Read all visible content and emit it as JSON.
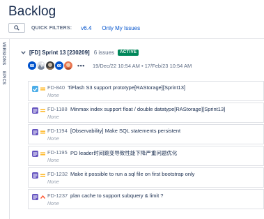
{
  "page": {
    "title": "Backlog"
  },
  "filters": {
    "label": "QUICK FILTERS:",
    "items": [
      "v6.4",
      "Only My Issues"
    ]
  },
  "side_tabs": [
    "VERSIONS",
    "EPICS"
  ],
  "sprint": {
    "name": "[FD] Sprint 13 [230209]",
    "count": "6 issues",
    "status": "ACTIVE",
    "dates": "19/Dec/22 10:54 AM • 17/Feb/23 10:54 AM",
    "more": "•••"
  },
  "issues": [
    {
      "key": "FD-840",
      "summary": "TiFlash S3 support prototype[RAStorage][Sprint13]",
      "epic": "None",
      "type": "task",
      "priority": "medium"
    },
    {
      "key": "FD-1188",
      "summary": "Minmax index support float / double datatype[RAStorage][Sprint13]",
      "epic": "None",
      "type": "story",
      "priority": "medium"
    },
    {
      "key": "FD-1194",
      "summary": "[Observability] Make SQL statements persistent",
      "epic": "None",
      "type": "story",
      "priority": "medium"
    },
    {
      "key": "FD-1195",
      "summary": "PD leader时间跳变导致性能下降严重问题优化",
      "epic": "None",
      "type": "story",
      "priority": "medium"
    },
    {
      "key": "FD-1232",
      "summary": "Make it possible to run a sql file on first bootstrap only",
      "epic": "None",
      "type": "story",
      "priority": "medium"
    },
    {
      "key": "FD-1237",
      "summary": "plan cache to support subquery & limit ?",
      "epic": "None",
      "type": "story",
      "priority": "high"
    }
  ],
  "colors": {
    "accent": "#0052cc",
    "active": "#00875a",
    "task": "#4bade8",
    "story": "#6554c0",
    "priority_medium": "#ffab00",
    "priority_high": "#ff5630"
  }
}
